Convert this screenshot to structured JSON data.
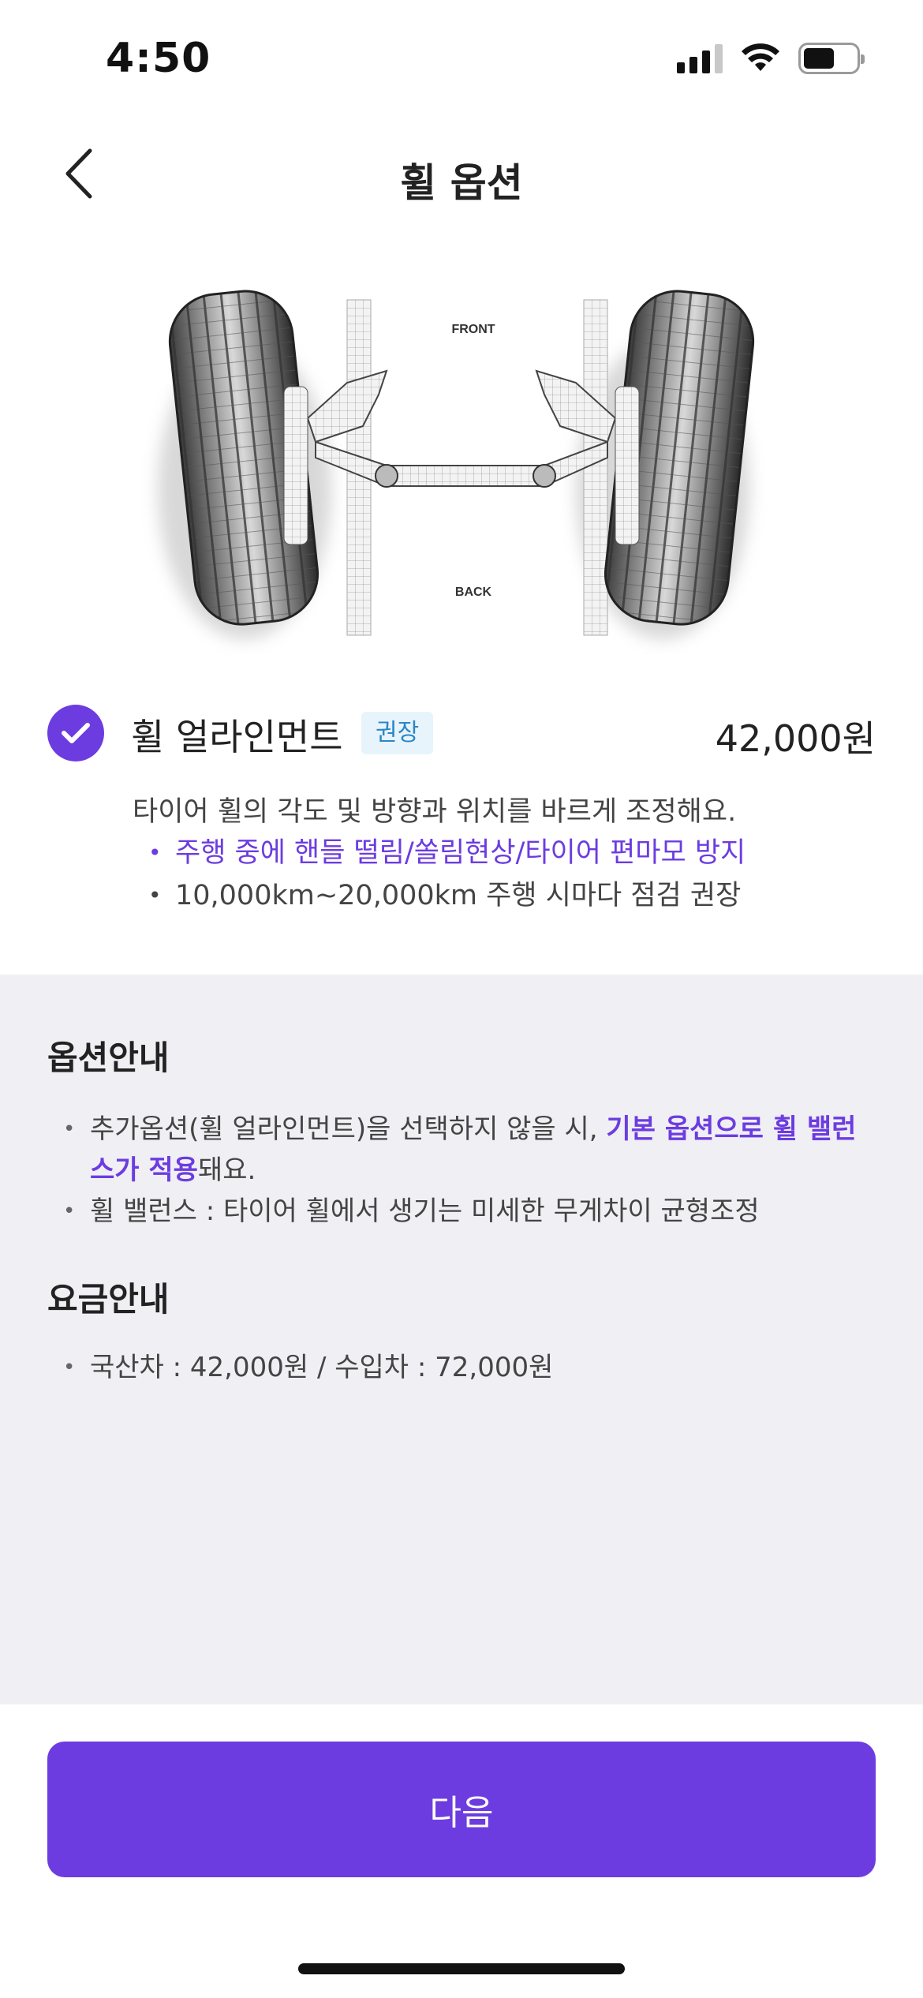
{
  "status_bar": {
    "time": "4:50"
  },
  "header": {
    "title": "휠 옵션"
  },
  "hero": {
    "front_label": "FRONT",
    "back_label": "BACK"
  },
  "option": {
    "name": "휠 얼라인먼트",
    "badge": "권장",
    "price": "42,000원",
    "selected": true,
    "description": "타이어 휠의 각도 및 방향과 위치를 바르게 조정해요.",
    "features": [
      "주행 중에 핸들 떨림/쏠림현상/타이어 편마모 방지",
      "10,000km~20,000km 주행 시마다 점검 권장"
    ]
  },
  "option_info": {
    "title": "옵션안내",
    "line1_prefix": "추가옵션(휠 얼라인먼트)을 선택하지 않을 시, ",
    "line1_highlight": "기본 옵션으로 휠 밸런스가 적용",
    "line1_suffix": "돼요.",
    "line2": "휠 밸런스 : 타이어 휠에서 생기는 미세한 무게차이 균형조정"
  },
  "price_info": {
    "title": "요금안내",
    "line1": "국산차 : 42,000원 / 수입차 : 72,000원"
  },
  "next_button": {
    "label": "다음"
  },
  "colors": {
    "accent": "#6c3ce0",
    "badge_bg": "#e8f4fb",
    "badge_text": "#2a87c7",
    "panel_bg": "#efeff4"
  }
}
